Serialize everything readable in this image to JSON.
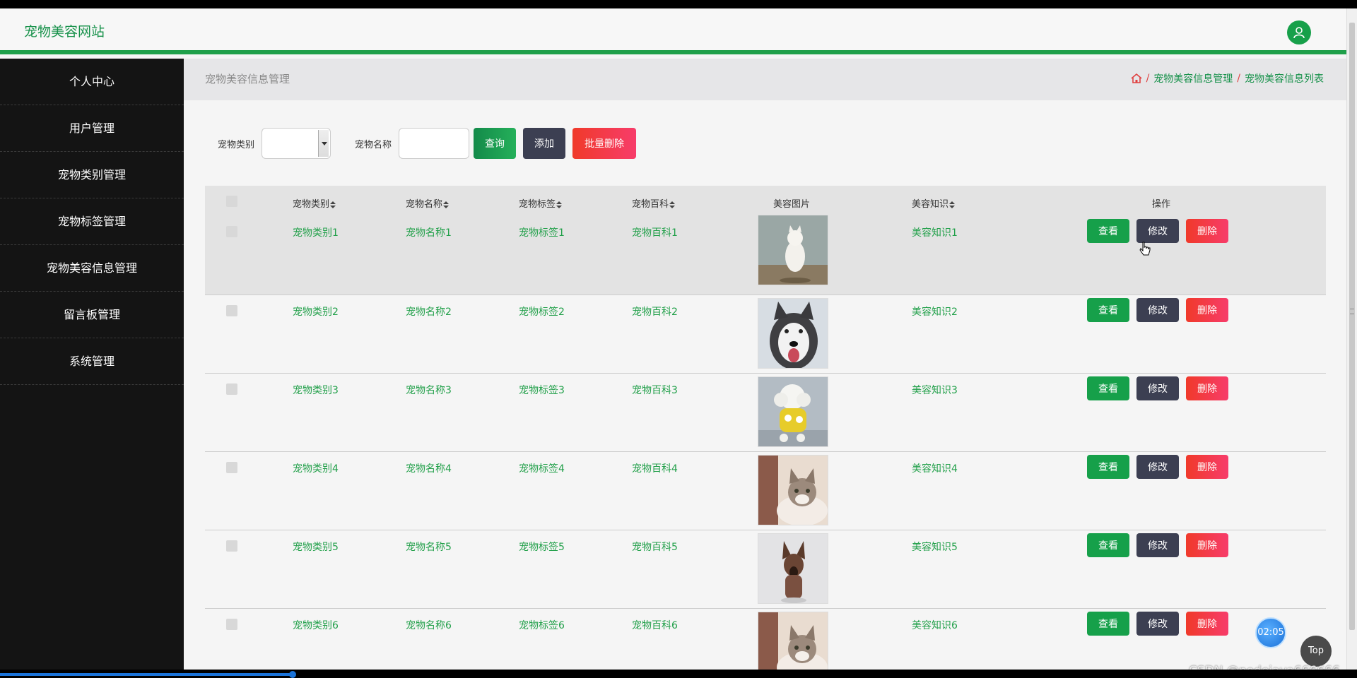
{
  "header": {
    "site_title": "宠物美容网站"
  },
  "sidebar": {
    "items": [
      {
        "label": "个人中心"
      },
      {
        "label": "用户管理"
      },
      {
        "label": "宠物类别管理"
      },
      {
        "label": "宠物标签管理"
      },
      {
        "label": "宠物美容信息管理"
      },
      {
        "label": "留言板管理"
      },
      {
        "label": "系统管理"
      }
    ]
  },
  "page": {
    "title": "宠物美容信息管理",
    "breadcrumb": [
      "宠物美容信息管理",
      "宠物美容信息列表"
    ],
    "breadcrumb_sep": "/"
  },
  "search": {
    "category_label": "宠物类别",
    "category_value": "",
    "name_label": "宠物名称",
    "name_value": "",
    "query_label": "查询",
    "add_label": "添加",
    "bulk_delete_label": "批量删除"
  },
  "table": {
    "columns": [
      "宠物类别",
      "宠物名称",
      "宠物标签",
      "宠物百科",
      "美容图片",
      "美容知识",
      "操作"
    ],
    "rows": [
      {
        "category": "宠物类别1",
        "name": "宠物名称1",
        "tag": "宠物标签1",
        "wiki": "宠物百科1",
        "image": "white-cat",
        "knowledge": "美容知识1"
      },
      {
        "category": "宠物类别2",
        "name": "宠物名称2",
        "tag": "宠物标签2",
        "wiki": "宠物百科2",
        "image": "husky",
        "knowledge": "美容知识2"
      },
      {
        "category": "宠物类别3",
        "name": "宠物名称3",
        "tag": "宠物标签3",
        "wiki": "宠物百科3",
        "image": "white-poodle",
        "knowledge": "美容知识3"
      },
      {
        "category": "宠物类别4",
        "name": "宠物名称4",
        "tag": "宠物标签4",
        "wiki": "宠物百科4",
        "image": "tabby-cat",
        "knowledge": "美容知识4"
      },
      {
        "category": "宠物类别5",
        "name": "宠物名称5",
        "tag": "宠物标签5",
        "wiki": "宠物百科5",
        "image": "shepherd-dog",
        "knowledge": "美容知识5"
      },
      {
        "category": "宠物类别6",
        "name": "宠物名称6",
        "tag": "宠物标签6",
        "wiki": "宠物百科6",
        "image": "tabby-cat",
        "knowledge": "美容知识6"
      }
    ],
    "actions": {
      "view": "查看",
      "edit": "修改",
      "delete": "删除"
    }
  },
  "overlay": {
    "timer": "02:05",
    "top_label": "Top",
    "watermark": "CSDN @nodejava666666"
  },
  "colors": {
    "accent": "#1fa04a",
    "sidebar_bg": "#141414",
    "danger": "#f03a2a",
    "dark_button": "#3c3f52"
  },
  "progress": {
    "played_fraction": 0.216
  }
}
